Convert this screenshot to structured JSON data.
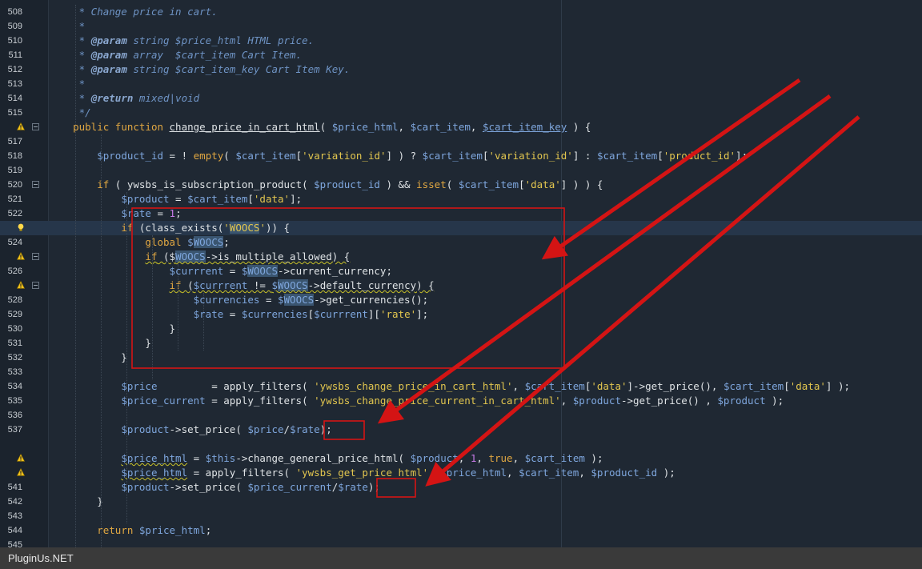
{
  "editor": {
    "lines": [
      {
        "n": "508",
        "t": [
          [
            "     * Change price in cart.",
            "c"
          ]
        ]
      },
      {
        "n": "509",
        "t": [
          [
            "     *",
            "c"
          ]
        ]
      },
      {
        "n": "510",
        "t": [
          [
            "     * ",
            "c"
          ],
          [
            "@param",
            "cd"
          ],
          [
            " string $price_html HTML price.",
            "c"
          ]
        ]
      },
      {
        "n": "511",
        "t": [
          [
            "     * ",
            "c"
          ],
          [
            "@param",
            "cd"
          ],
          [
            " array  $cart_item Cart Item.",
            "c"
          ]
        ]
      },
      {
        "n": "512",
        "t": [
          [
            "     * ",
            "c"
          ],
          [
            "@param",
            "cd"
          ],
          [
            " string $cart_item_key Cart Item Key.",
            "c"
          ]
        ]
      },
      {
        "n": "513",
        "t": [
          [
            "     *",
            "c"
          ]
        ]
      },
      {
        "n": "514",
        "t": [
          [
            "     * ",
            "c"
          ],
          [
            "@return",
            "cd"
          ],
          [
            " mixed|void",
            "c"
          ]
        ]
      },
      {
        "n": "515",
        "t": [
          [
            "     */",
            "c"
          ]
        ]
      },
      {
        "n": "",
        "mark": "warning",
        "fold": true,
        "t": [
          [
            "    ",
            "p"
          ],
          [
            "public function ",
            "k"
          ],
          [
            "change_price_in_cart_html",
            "p ul"
          ],
          [
            "( ",
            "p"
          ],
          [
            "$price_html",
            "v"
          ],
          [
            ", ",
            "p"
          ],
          [
            "$cart_item",
            "v"
          ],
          [
            ", ",
            "p"
          ],
          [
            "$cart_item_key",
            "v ul"
          ],
          [
            " ) {",
            "p"
          ]
        ]
      },
      {
        "n": "517",
        "t": []
      },
      {
        "n": "518",
        "t": [
          [
            "        ",
            "p"
          ],
          [
            "$product_id",
            "v"
          ],
          [
            " = ! ",
            "p"
          ],
          [
            "empty",
            "k"
          ],
          [
            "( ",
            "p"
          ],
          [
            "$cart_item",
            "v"
          ],
          [
            "[",
            "p"
          ],
          [
            "'variation_id'",
            "s"
          ],
          [
            "] ) ? ",
            "p"
          ],
          [
            "$cart_item",
            "v"
          ],
          [
            "[",
            "p"
          ],
          [
            "'variation_id'",
            "s"
          ],
          [
            "] : ",
            "p"
          ],
          [
            "$cart_item",
            "v"
          ],
          [
            "[",
            "p"
          ],
          [
            "'product_id'",
            "s"
          ],
          [
            "];",
            "p"
          ]
        ]
      },
      {
        "n": "519",
        "t": []
      },
      {
        "n": "520",
        "fold": true,
        "t": [
          [
            "        ",
            "p"
          ],
          [
            "if",
            "k"
          ],
          [
            " ( ywsbs_is_subscription_product( ",
            "p"
          ],
          [
            "$product_id",
            "v"
          ],
          [
            " ) && ",
            "p"
          ],
          [
            "isset",
            "k"
          ],
          [
            "( ",
            "p"
          ],
          [
            "$cart_item",
            "v"
          ],
          [
            "[",
            "p"
          ],
          [
            "'data'",
            "s"
          ],
          [
            "] ) ) {",
            "p"
          ]
        ]
      },
      {
        "n": "521",
        "t": [
          [
            "            ",
            "p"
          ],
          [
            "$product",
            "v"
          ],
          [
            " = ",
            "p"
          ],
          [
            "$cart_item",
            "v"
          ],
          [
            "[",
            "p"
          ],
          [
            "'data'",
            "s"
          ],
          [
            "];",
            "p"
          ]
        ]
      },
      {
        "n": "522",
        "t": [
          [
            "            ",
            "p"
          ],
          [
            "$rate",
            "v"
          ],
          [
            " = ",
            "p"
          ],
          [
            "1",
            "n"
          ],
          [
            ";",
            "p"
          ]
        ]
      },
      {
        "n": "",
        "mark": "bulb",
        "current": true,
        "t": [
          [
            "            ",
            "p"
          ],
          [
            "if",
            "k"
          ],
          [
            " (class_exists(",
            "p"
          ],
          [
            "'",
            "s"
          ],
          [
            "WOOCS",
            "s hl"
          ],
          [
            "'",
            "s"
          ],
          [
            ")) {",
            "p"
          ]
        ]
      },
      {
        "n": "524",
        "t": [
          [
            "                ",
            "p"
          ],
          [
            "global",
            "k"
          ],
          [
            " ",
            "p"
          ],
          [
            "$",
            "v"
          ],
          [
            "WOOCS",
            "v hl"
          ],
          [
            ";",
            "p"
          ]
        ]
      },
      {
        "n": "",
        "mark": "warning",
        "fold": true,
        "t": [
          [
            "                ",
            "p"
          ],
          [
            "if",
            "k wv"
          ],
          [
            " ($",
            "p wv"
          ],
          [
            "WOOCS",
            "v hl wv"
          ],
          [
            "->is_multiple_allowed) {",
            "p wv"
          ]
        ]
      },
      {
        "n": "526",
        "t": [
          [
            "                    ",
            "p"
          ],
          [
            "$currrent",
            "v"
          ],
          [
            " = ",
            "p"
          ],
          [
            "$",
            "v"
          ],
          [
            "WOOCS",
            "v hl"
          ],
          [
            "->current_currency;",
            "p"
          ]
        ]
      },
      {
        "n": "",
        "mark": "warning",
        "fold": true,
        "t": [
          [
            "                    ",
            "p"
          ],
          [
            "if",
            "k wv"
          ],
          [
            " (",
            "p wv"
          ],
          [
            "$currrent",
            "v wv"
          ],
          [
            " != ",
            "p wv"
          ],
          [
            "$",
            "v wv"
          ],
          [
            "WOOCS",
            "v hl wv"
          ],
          [
            "->default_currency) {",
            "p wv"
          ]
        ]
      },
      {
        "n": "528",
        "t": [
          [
            "                        ",
            "p"
          ],
          [
            "$currencies",
            "v"
          ],
          [
            " = ",
            "p"
          ],
          [
            "$",
            "v"
          ],
          [
            "WOOCS",
            "v hl"
          ],
          [
            "->get_currencies();",
            "p"
          ]
        ]
      },
      {
        "n": "529",
        "t": [
          [
            "                        ",
            "p"
          ],
          [
            "$rate",
            "v"
          ],
          [
            " = ",
            "p"
          ],
          [
            "$currencies",
            "v"
          ],
          [
            "[",
            "p"
          ],
          [
            "$currrent",
            "v"
          ],
          [
            "][",
            "p"
          ],
          [
            "'rate'",
            "s"
          ],
          [
            "];",
            "p"
          ]
        ]
      },
      {
        "n": "530",
        "t": [
          [
            "                    }",
            "p"
          ]
        ]
      },
      {
        "n": "531",
        "t": [
          [
            "                }",
            "p"
          ]
        ]
      },
      {
        "n": "532",
        "t": [
          [
            "            }",
            "p"
          ]
        ]
      },
      {
        "n": "533",
        "t": []
      },
      {
        "n": "534",
        "t": [
          [
            "            ",
            "p"
          ],
          [
            "$price",
            "v"
          ],
          [
            "         = apply_filters( ",
            "p"
          ],
          [
            "'ywsbs_change_price_in_cart_html'",
            "s"
          ],
          [
            ", ",
            "p"
          ],
          [
            "$cart_item",
            "v"
          ],
          [
            "[",
            "p"
          ],
          [
            "'data'",
            "s"
          ],
          [
            "]->get_price(), ",
            "p"
          ],
          [
            "$cart_item",
            "v"
          ],
          [
            "[",
            "p"
          ],
          [
            "'data'",
            "s"
          ],
          [
            "] );",
            "p"
          ]
        ]
      },
      {
        "n": "535",
        "t": [
          [
            "            ",
            "p"
          ],
          [
            "$price_current",
            "v"
          ],
          [
            " = apply_filters( ",
            "p"
          ],
          [
            "'ywsbs_change_price_current_in_cart_html'",
            "s"
          ],
          [
            ", ",
            "p"
          ],
          [
            "$product",
            "v"
          ],
          [
            "->get_price() , ",
            "p"
          ],
          [
            "$product",
            "v"
          ],
          [
            " );",
            "p"
          ]
        ]
      },
      {
        "n": "536",
        "t": []
      },
      {
        "n": "537",
        "t": [
          [
            "            ",
            "p"
          ],
          [
            "$product",
            "v"
          ],
          [
            "->set_price( ",
            "p"
          ],
          [
            "$price",
            "v"
          ],
          [
            "/",
            "p"
          ],
          [
            "$rate",
            "v"
          ],
          [
            ");",
            "p"
          ]
        ]
      },
      {
        "n": "",
        "t": []
      },
      {
        "n": "",
        "mark": "warning",
        "t": [
          [
            "            ",
            "p"
          ],
          [
            "$price_html",
            "v wv"
          ],
          [
            " = ",
            "p"
          ],
          [
            "$this",
            "v"
          ],
          [
            "->change_general_price_html( ",
            "p"
          ],
          [
            "$product",
            "v"
          ],
          [
            ", ",
            "p"
          ],
          [
            "1",
            "n"
          ],
          [
            ", ",
            "p"
          ],
          [
            "true",
            "k"
          ],
          [
            ", ",
            "p"
          ],
          [
            "$cart_item",
            "v"
          ],
          [
            " );",
            "p"
          ]
        ]
      },
      {
        "n": "",
        "mark": "warning",
        "t": [
          [
            "            ",
            "p"
          ],
          [
            "$price_html",
            "v wv"
          ],
          [
            " = apply_filters( ",
            "p"
          ],
          [
            "'ywsbs_get_price_html'",
            "s"
          ],
          [
            ", ",
            "p"
          ],
          [
            "$price_html",
            "v"
          ],
          [
            ", ",
            "p"
          ],
          [
            "$cart_item",
            "v"
          ],
          [
            ", ",
            "p"
          ],
          [
            "$product_id",
            "v"
          ],
          [
            " );",
            "p"
          ]
        ]
      },
      {
        "n": "541",
        "t": [
          [
            "            ",
            "p"
          ],
          [
            "$product",
            "v"
          ],
          [
            "->set_price( ",
            "p"
          ],
          [
            "$price_current",
            "v"
          ],
          [
            "/",
            "p"
          ],
          [
            "$rate",
            "v"
          ],
          [
            ");",
            "p"
          ]
        ]
      },
      {
        "n": "542",
        "t": [
          [
            "        }",
            "p"
          ]
        ]
      },
      {
        "n": "543",
        "t": []
      },
      {
        "n": "544",
        "t": [
          [
            "        ",
            "p"
          ],
          [
            "return",
            "k"
          ],
          [
            " ",
            "p"
          ],
          [
            "$price_html",
            "v"
          ],
          [
            ";",
            "p"
          ]
        ]
      },
      {
        "n": "545",
        "t": []
      }
    ]
  },
  "status_bar": {
    "text": "PluginUs.NET"
  },
  "colors": {
    "background": "#1f2833",
    "keyword": "#e0a742",
    "variable": "#7ea6dd",
    "string": "#e2c64f",
    "comment": "#6e93c4",
    "annotation": "#d41414"
  },
  "icons": {
    "warning": "warning-icon",
    "bulb": "lightbulb-icon",
    "fold": "fold-toggle-icon"
  }
}
